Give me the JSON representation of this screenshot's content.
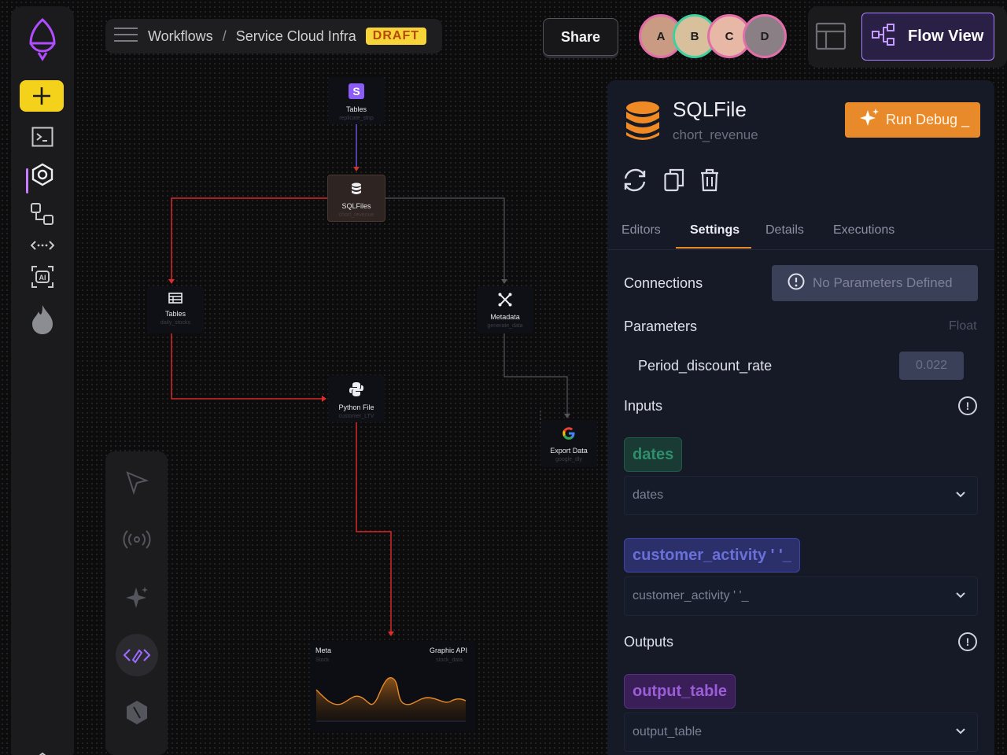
{
  "breadcrumb": {
    "root": "Workflows",
    "separator": "/",
    "current": "Service Cloud Infra",
    "status": "DRAFT"
  },
  "header": {
    "share_label": "Share",
    "flow_view_label": "Flow View",
    "avatars": [
      "A",
      "B",
      "C",
      "D"
    ]
  },
  "nodes": {
    "tables_top": {
      "label": "Tables",
      "sub": "replicate_stnp"
    },
    "sqlfiles": {
      "label": "SQLFiles",
      "sub": "chort_revenue"
    },
    "tables_left": {
      "label": "Tables",
      "sub": "daily_stocks"
    },
    "metadata": {
      "label": "Metadata",
      "sub": "generate_data"
    },
    "python": {
      "label": "Python File",
      "sub": "customer_LTV"
    },
    "export": {
      "label": "Export Data",
      "sub": "google_dly"
    },
    "chart_card": {
      "left_title": "Meta",
      "left_sub": "Stock",
      "right_title": "Graphic API",
      "right_sub": "stock_data"
    }
  },
  "panel": {
    "title": "SQLFile",
    "subtitle": "chort_revenue",
    "run_debug_label": "Run Debug _",
    "tabs": [
      "Editors",
      "Settings",
      "Details",
      "Executions"
    ],
    "active_tab": "Settings",
    "connections_label": "Connections",
    "no_params_label": "No Parameters Defined",
    "parameters_label": "Parameters",
    "param_type": "Float",
    "param_name": "Period_discount_rate",
    "param_value": "0.022",
    "inputs_label": "Inputs",
    "input1_chip": "dates",
    "input1_select": "dates",
    "input2_chip": "customer_activity ' '_",
    "input2_select": "customer_activity ' '_",
    "outputs_label": "Outputs",
    "output_chip": "output_table",
    "output_select": "output_table"
  },
  "colors": {
    "accent": "#e98a2a",
    "brand": "#c77dff",
    "draft": "#f6d43a"
  }
}
